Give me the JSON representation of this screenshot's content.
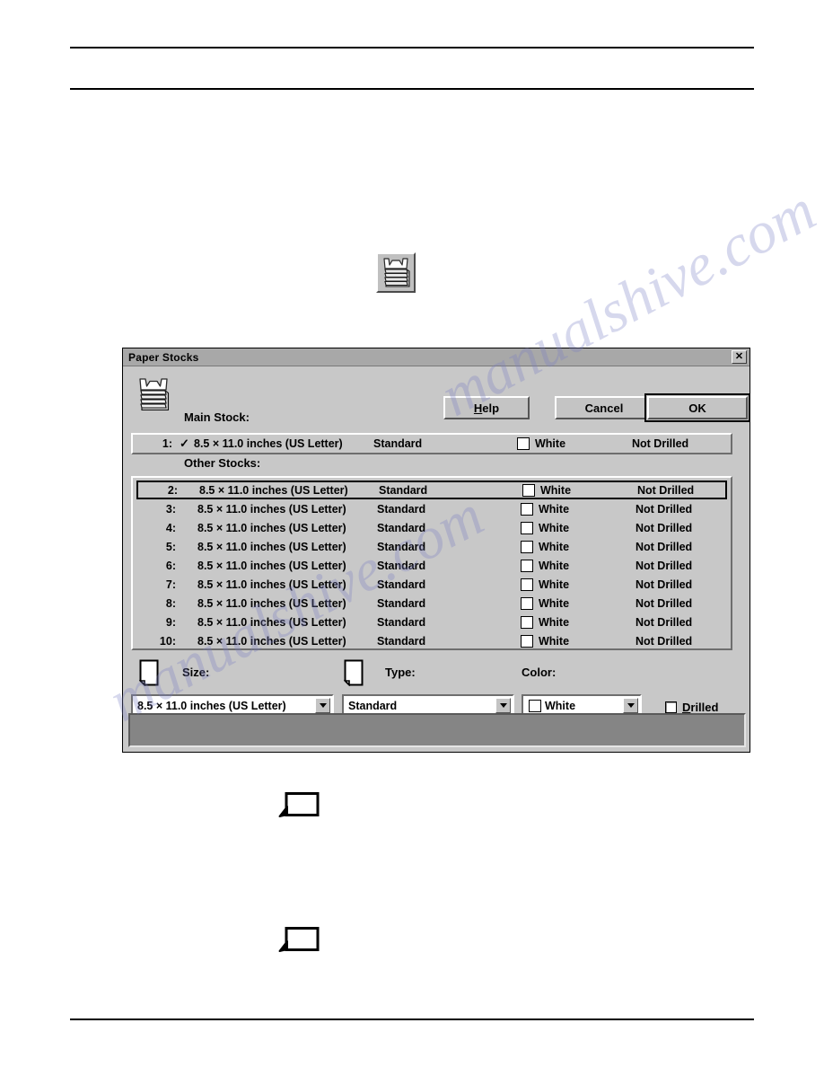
{
  "document": {
    "has_top_rules": true,
    "has_bottom_rule": true,
    "watermark_1": "manualshive.com",
    "watermark_2": "manualshive.com"
  },
  "toolbar": {
    "stack_button_name": "paper-stocks-toolbar-button",
    "icon": "paper-stack-icon"
  },
  "callouts": [
    {
      "name": "callout-note-1"
    },
    {
      "name": "callout-note-2"
    }
  ],
  "dialog": {
    "title": "Paper Stocks",
    "close_label": "✕",
    "icon": "paper-stack-icon",
    "main_stock_label": "Main Stock:",
    "other_stocks_label": "Other Stocks:",
    "buttons": {
      "help": {
        "pre": "",
        "accel": "H",
        "post": "elp"
      },
      "cancel": "Cancel",
      "ok": "OK"
    },
    "main_stock_row": {
      "number": "1:",
      "check": "✓",
      "size": "8.5 × 11.0 inches (US Letter)",
      "type": "Standard",
      "color": "White",
      "drilled": "Not Drilled"
    },
    "other_stocks": [
      {
        "number": "2:",
        "size": "8.5 × 11.0 inches (US Letter)",
        "type": "Standard",
        "color": "White",
        "drilled": "Not Drilled",
        "selected": true
      },
      {
        "number": "3:",
        "size": "8.5 × 11.0 inches (US Letter)",
        "type": "Standard",
        "color": "White",
        "drilled": "Not Drilled",
        "selected": false
      },
      {
        "number": "4:",
        "size": "8.5 × 11.0 inches (US Letter)",
        "type": "Standard",
        "color": "White",
        "drilled": "Not Drilled",
        "selected": false
      },
      {
        "number": "5:",
        "size": "8.5 × 11.0 inches (US Letter)",
        "type": "Standard",
        "color": "White",
        "drilled": "Not Drilled",
        "selected": false
      },
      {
        "number": "6:",
        "size": "8.5 × 11.0 inches (US Letter)",
        "type": "Standard",
        "color": "White",
        "drilled": "Not Drilled",
        "selected": false
      },
      {
        "number": "7:",
        "size": "8.5 × 11.0 inches (US Letter)",
        "type": "Standard",
        "color": "White",
        "drilled": "Not Drilled",
        "selected": false
      },
      {
        "number": "8:",
        "size": "8.5 × 11.0 inches (US Letter)",
        "type": "Standard",
        "color": "White",
        "drilled": "Not Drilled",
        "selected": false
      },
      {
        "number": "9:",
        "size": "8.5 × 11.0 inches (US Letter)",
        "type": "Standard",
        "color": "White",
        "drilled": "Not Drilled",
        "selected": false
      },
      {
        "number": "10:",
        "size": "8.5 × 11.0 inches (US Letter)",
        "type": "Standard",
        "color": "White",
        "drilled": "Not Drilled",
        "selected": false
      }
    ],
    "controls": {
      "size": {
        "label": "Size:",
        "value": "8.5 × 11.0 inches (US Letter)"
      },
      "type": {
        "label": "Type:",
        "value": "Standard"
      },
      "color": {
        "label": "Color:",
        "value": "White",
        "swatch": "#ffffff"
      },
      "drilled": {
        "label_pre": "",
        "label_accel": "D",
        "label_post": "rilled",
        "checked": false
      }
    }
  },
  "colors": {
    "dialog_face": "#c8c8c8",
    "titlebar": "#a8a8a8",
    "button_face": "#c4c4c4",
    "status_strip": "#858585",
    "field_bg": "#ffffff",
    "text": "#000000"
  }
}
